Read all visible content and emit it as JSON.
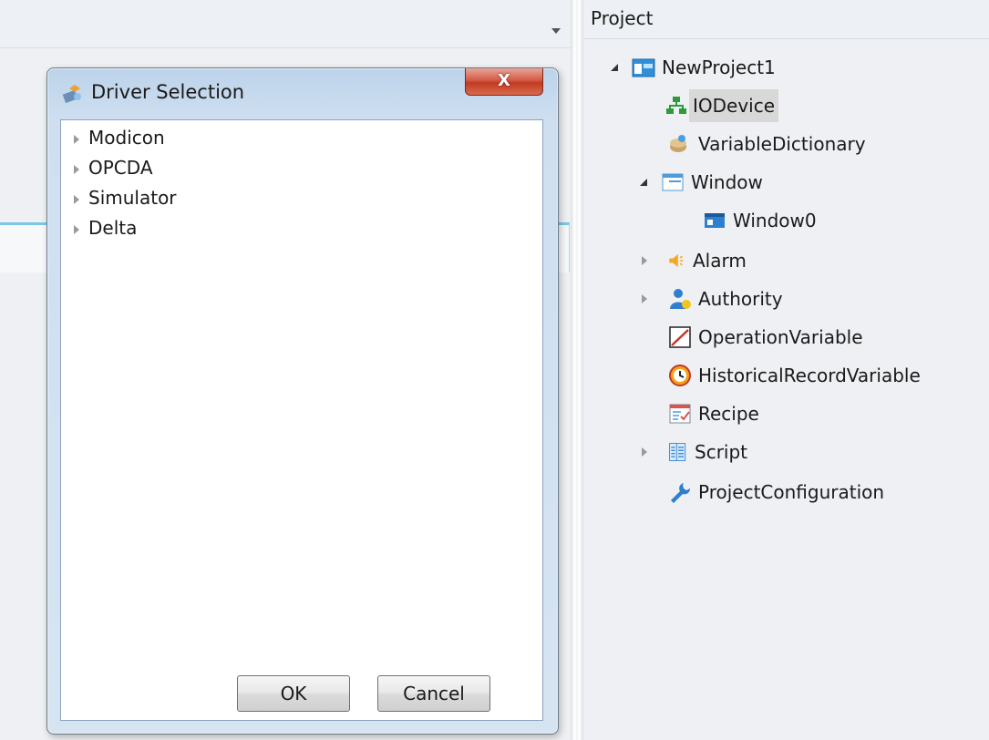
{
  "panel": {
    "title": "Project",
    "tree": [
      {
        "label": "NewProject1",
        "icon": "project-icon",
        "expander": "expanded"
      },
      {
        "label": "IODevice",
        "icon": "io-device-icon",
        "selected": true
      },
      {
        "label": "VariableDictionary",
        "icon": "variable-dictionary-icon"
      },
      {
        "label": "Window",
        "icon": "window-icon",
        "expander": "expanded"
      },
      {
        "label": "Window0",
        "icon": "window-item-icon"
      },
      {
        "label": "Alarm",
        "icon": "alarm-icon",
        "expander": "collapsed"
      },
      {
        "label": "Authority",
        "icon": "authority-icon",
        "expander": "collapsed"
      },
      {
        "label": "OperationVariable",
        "icon": "operation-variable-icon"
      },
      {
        "label": "HistoricalRecordVariable",
        "icon": "historical-record-icon"
      },
      {
        "label": "Recipe",
        "icon": "recipe-icon"
      },
      {
        "label": "Script",
        "icon": "script-icon",
        "expander": "collapsed"
      },
      {
        "label": "ProjectConfiguration",
        "icon": "wrench-icon"
      }
    ]
  },
  "dialog": {
    "title": "Driver Selection",
    "close_label": "X",
    "drivers": [
      "Modicon",
      "OPCDA",
      "Simulator",
      "Delta"
    ],
    "ok_label": "OK",
    "cancel_label": "Cancel"
  }
}
